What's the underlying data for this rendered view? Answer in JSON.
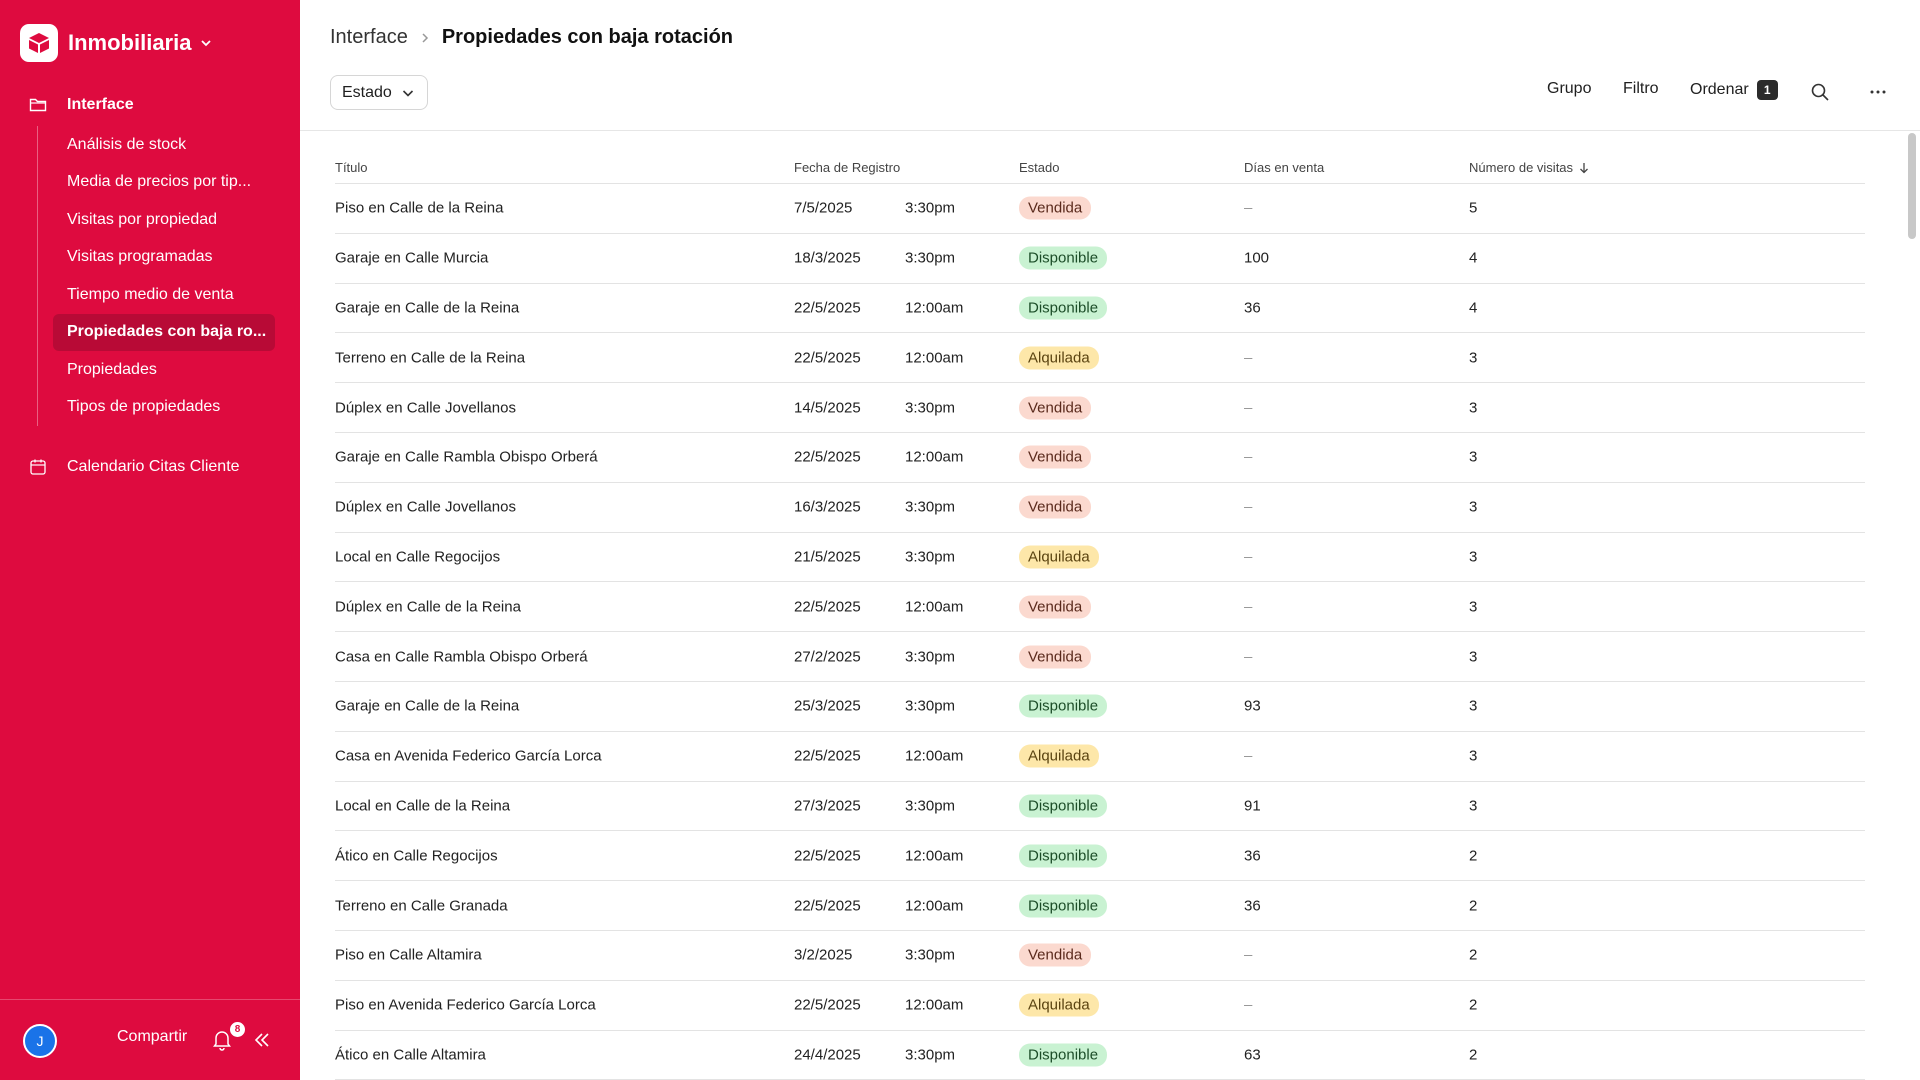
{
  "app": {
    "name": "Inmobiliaria"
  },
  "sidebar": {
    "group_label": "Interface",
    "items": [
      {
        "label": "Análisis de stock"
      },
      {
        "label": "Media de precios por tip..."
      },
      {
        "label": "Visitas por propiedad"
      },
      {
        "label": "Visitas programadas"
      },
      {
        "label": "Tiempo medio de venta"
      },
      {
        "label": "Propiedades con baja ro..."
      },
      {
        "label": "Propiedades"
      },
      {
        "label": "Tipos de propiedades"
      }
    ],
    "calendar_label": "Calendario Citas Cliente",
    "footer": {
      "avatar_initial": "J",
      "share_label": "Compartir",
      "notification_count": "8"
    }
  },
  "header": {
    "breadcrumb_root": "Interface",
    "breadcrumb_current": "Propiedades con baja rotación",
    "estado_filter_label": "Estado",
    "grupo_label": "Grupo",
    "filtro_label": "Filtro",
    "ordenar_label": "Ordenar",
    "ordenar_count": "1"
  },
  "table": {
    "columns": {
      "titulo": "Título",
      "fecha": "Fecha de Registro",
      "estado": "Estado",
      "dias": "Días en venta",
      "visitas": "Número de visitas"
    },
    "rows": [
      {
        "titulo": "Piso en Calle de la Reina",
        "fecha": "7/5/2025",
        "hora": "3:30pm",
        "estado": "Vendida",
        "dias": "–",
        "visitas": "5"
      },
      {
        "titulo": "Garaje en Calle Murcia",
        "fecha": "18/3/2025",
        "hora": "3:30pm",
        "estado": "Disponible",
        "dias": "100",
        "visitas": "4"
      },
      {
        "titulo": "Garaje en Calle de la Reina",
        "fecha": "22/5/2025",
        "hora": "12:00am",
        "estado": "Disponible",
        "dias": "36",
        "visitas": "4"
      },
      {
        "titulo": "Terreno en Calle de la Reina",
        "fecha": "22/5/2025",
        "hora": "12:00am",
        "estado": "Alquilada",
        "dias": "–",
        "visitas": "3"
      },
      {
        "titulo": "Dúplex en Calle Jovellanos",
        "fecha": "14/5/2025",
        "hora": "3:30pm",
        "estado": "Vendida",
        "dias": "–",
        "visitas": "3"
      },
      {
        "titulo": "Garaje en Calle Rambla Obispo Orberá",
        "fecha": "22/5/2025",
        "hora": "12:00am",
        "estado": "Vendida",
        "dias": "–",
        "visitas": "3"
      },
      {
        "titulo": "Dúplex en Calle Jovellanos",
        "fecha": "16/3/2025",
        "hora": "3:30pm",
        "estado": "Vendida",
        "dias": "–",
        "visitas": "3"
      },
      {
        "titulo": "Local en Calle Regocijos",
        "fecha": "21/5/2025",
        "hora": "3:30pm",
        "estado": "Alquilada",
        "dias": "–",
        "visitas": "3"
      },
      {
        "titulo": "Dúplex en Calle de la Reina",
        "fecha": "22/5/2025",
        "hora": "12:00am",
        "estado": "Vendida",
        "dias": "–",
        "visitas": "3"
      },
      {
        "titulo": "Casa en Calle Rambla Obispo Orberá",
        "fecha": "27/2/2025",
        "hora": "3:30pm",
        "estado": "Vendida",
        "dias": "–",
        "visitas": "3"
      },
      {
        "titulo": "Garaje en Calle de la Reina",
        "fecha": "25/3/2025",
        "hora": "3:30pm",
        "estado": "Disponible",
        "dias": "93",
        "visitas": "3"
      },
      {
        "titulo": "Casa en Avenida Federico García Lorca",
        "fecha": "22/5/2025",
        "hora": "12:00am",
        "estado": "Alquilada",
        "dias": "–",
        "visitas": "3"
      },
      {
        "titulo": "Local en Calle de la Reina",
        "fecha": "27/3/2025",
        "hora": "3:30pm",
        "estado": "Disponible",
        "dias": "91",
        "visitas": "3"
      },
      {
        "titulo": "Ático en Calle Regocijos",
        "fecha": "22/5/2025",
        "hora": "12:00am",
        "estado": "Disponible",
        "dias": "36",
        "visitas": "2"
      },
      {
        "titulo": "Terreno en Calle Granada",
        "fecha": "22/5/2025",
        "hora": "12:00am",
        "estado": "Disponible",
        "dias": "36",
        "visitas": "2"
      },
      {
        "titulo": "Piso en Calle Altamira",
        "fecha": "3/2/2025",
        "hora": "3:30pm",
        "estado": "Vendida",
        "dias": "–",
        "visitas": "2"
      },
      {
        "titulo": "Piso en Avenida Federico García Lorca",
        "fecha": "22/5/2025",
        "hora": "12:00am",
        "estado": "Alquilada",
        "dias": "–",
        "visitas": "2"
      },
      {
        "titulo": "Ático en Calle Altamira",
        "fecha": "24/4/2025",
        "hora": "3:30pm",
        "estado": "Disponible",
        "dias": "63",
        "visitas": "2"
      }
    ]
  },
  "colors": {
    "brand": "#de0b3f",
    "sidebar_active": "#b80a36",
    "pill_vendida": "#fbd9cf",
    "pill_disponible": "#c9f2d2",
    "pill_alquilada": "#fde7a9"
  },
  "icons": [
    "logo-icon",
    "chevron-down-icon",
    "folder-icon",
    "calendar-icon",
    "chevron-right-icon",
    "search-icon",
    "more-icon",
    "sort-arrow-down-icon",
    "bell-icon",
    "collapse-sidebar-icon"
  ]
}
